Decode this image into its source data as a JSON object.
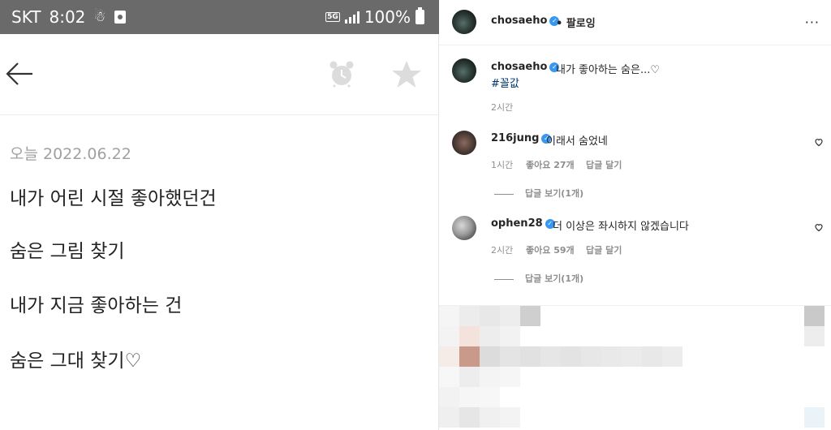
{
  "status_bar": {
    "carrier": "SKT",
    "time": "8:02",
    "network": "5G",
    "battery": "100%"
  },
  "memo": {
    "icons": [
      "back-arrow-icon",
      "alarm-icon",
      "star-icon"
    ],
    "date": "오늘 2022.06.22",
    "lines": [
      "내가 어린 시절 좋아했던건",
      "숨은 그림 찾기",
      "내가 지금 좋아하는 건",
      "숨은 그대 찾기♡"
    ]
  },
  "instagram": {
    "header": {
      "username": "chosaeho",
      "follow_label": "팔로잉",
      "more_label": "···"
    },
    "post": {
      "username": "chosaeho",
      "caption": "내가 좋아하는 숨은...♡",
      "hashtag": "#꼴값",
      "time": "2시간"
    },
    "comments": [
      {
        "username": "216jung",
        "text": "이래서 숨었네",
        "time": "1시간",
        "likes": "좋아요 27개",
        "reply_label": "답글 달기",
        "view_replies": "답글 보기(1개)"
      },
      {
        "username": "ophen28",
        "text": "더 이상은 좌시하지 않겠습니다",
        "time": "2시간",
        "likes": "좋아요 59개",
        "reply_label": "답글 달기",
        "view_replies": "답글 보기(1개)"
      }
    ],
    "colors": {
      "verified": "#3897f0",
      "hashtag": "#00376b",
      "secondary_text": "#8e8e8e"
    }
  }
}
